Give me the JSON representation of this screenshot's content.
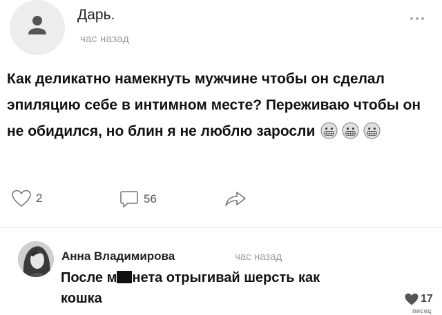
{
  "post": {
    "author": "Дарь.",
    "time": "час назад",
    "text": "Как деликатно намекнуть мужчине чтобы он сделал эпиляцию себе в интимном месте? Переживаю чтобы он не обидился, но блин я не люблю заросли",
    "emojis": [
      "grimacing-face",
      "grimacing-face",
      "grimacing-face"
    ],
    "likes": "2",
    "comments": "56"
  },
  "comment": {
    "author": "Анна Владимирова",
    "time": "час назад",
    "text_before": "После м",
    "text_after": "нета отрыгивай шерсть как кошка",
    "likes": "17"
  },
  "watermark": "писец"
}
